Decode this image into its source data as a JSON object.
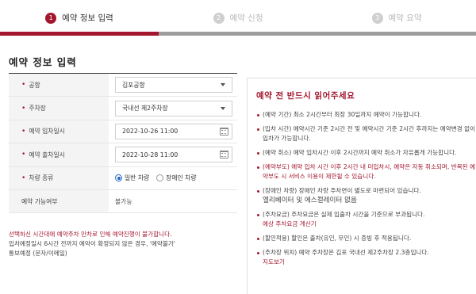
{
  "steps": [
    {
      "num": "1",
      "label": "예약 정보 입력"
    },
    {
      "num": "2",
      "label": "예약 신청"
    },
    {
      "num": "3",
      "label": "예약 요약"
    }
  ],
  "section_title": "예약 정보 입력",
  "form": {
    "airport": {
      "label": "공항",
      "value": "김포공항"
    },
    "parking": {
      "label": "주차장",
      "value": "국내선 제2주차장"
    },
    "entry": {
      "label": "예약 입차일시",
      "value": "2022-10-26 11:00"
    },
    "exit": {
      "label": "예약 출차일시",
      "value": "2022-10-28 11:00"
    },
    "vehicle": {
      "label": "차량 종류",
      "option1": "일반 차량",
      "option2": "장애인 차량"
    },
    "availability": {
      "label": "예약 가능여부",
      "value": "불가능"
    }
  },
  "notes": {
    "warning": "선택하신 시간대에 예약주차 만차로 인해 예약진행이 불가합니다.",
    "info1": "입차예정일시 6시간 전까지 예약이 확정되지 않은 경우, '예약불가'",
    "info2": "통보예정 (문자/이메일)"
  },
  "panel": {
    "title": "예약 전 반드시 읽어주세요",
    "item1": "(예약 기간) 최소 2시간부터 최장 30일까지 예약이 가능합니다.",
    "item2": "(입차 시간) 예약시간 기준 2시간 전 및 예약시간 기준 2시간 후까지는 예약변경 없이 입차가 가능합니다.",
    "item3": "(예약 취소) 예약 입차시간 이후 2시간까지 예약 취소가 자유롭게 가능합니다.",
    "item4": "(예약부도) 예약 입차 시간 이후 2시간 내 미입차시, 예약은 자동 취소되며, 반복된 예약부도 시 서비스 이용이 제한될 수 있습니다.",
    "item5a": "(장애인 차량) 장애인 차량 주차면이 별도로 마련되어 있습니다.",
    "item5b": "엘리베이터 및 에스컬레이터 없음",
    "item6": "(주차요금) 주차요금은 실제 입출차 시간을 기준으로 부과됩니다.",
    "item6_link": "예상 주차요금 계산기",
    "item7": "(할인적용) 할인은 출차(유인, 무인) 시 증빙 후 적용됩니다.",
    "item8": "(주차장 위치) 예약 주차장은 김포 국내선 제2주차장 2.3층입니다.",
    "item8_link": "지도보기"
  },
  "colors": {
    "accent": "#a3162d",
    "progress_gray": "#9d9d9d",
    "radio": "#1e66c8"
  }
}
